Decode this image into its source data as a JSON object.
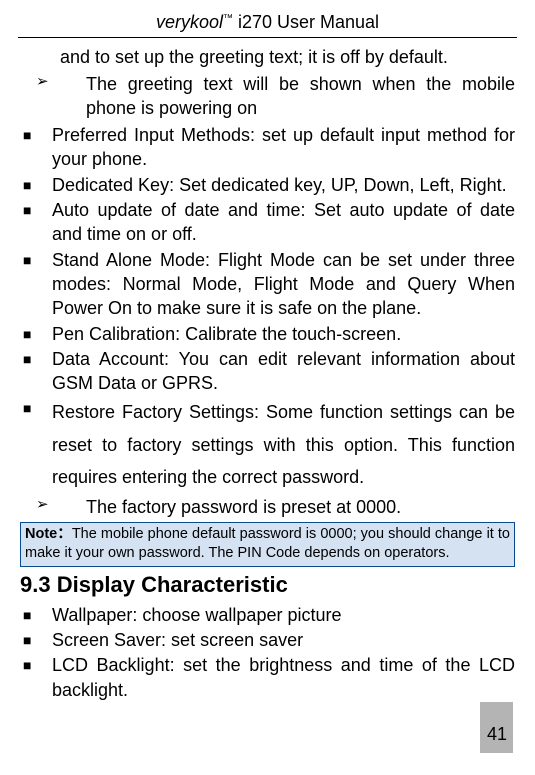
{
  "header": {
    "brand": "verykool",
    "tm": "™",
    "rest": " i270 User Manual"
  },
  "intro_line": "and to set up the greeting text; it is off by default.",
  "arrow1": "The greeting text will be shown when the mobile phone is powering on",
  "items": [
    "Preferred Input Methods: set up default input method for your phone.",
    "Dedicated Key: Set dedicated key, UP, Down, Left, Right.",
    "Auto update of date and time: Set auto update of date and time on or off.",
    "Stand Alone Mode: Flight Mode can be set under three modes: Normal Mode, Flight Mode and Query When Power On to make sure it is safe on the plane.",
    "Pen Calibration: Calibrate the touch-screen.",
    "Data Account: You can edit relevant information about GSM Data or GPRS."
  ],
  "restore_item": "Restore Factory Settings: Some function settings can be reset to factory settings with this option. This function requires entering the correct password.",
  "arrow2": "The factory password is preset at 0000.",
  "note": {
    "label": "Note：",
    "text": "The mobile phone default password is 0000; you should change it to make it your own password. The PIN Code depends on operators."
  },
  "section_title": "9.3 Display Characteristic",
  "display_items": [
    "Wallpaper: choose wallpaper picture",
    "Screen Saver: set screen saver",
    "LCD Backlight: set the brightness and time of the LCD backlight."
  ],
  "page_number": "41"
}
